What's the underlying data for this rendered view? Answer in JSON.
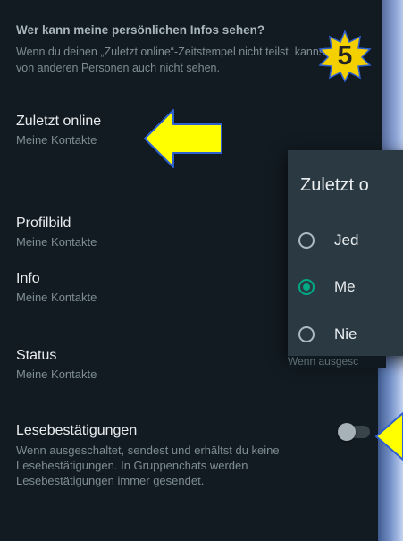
{
  "header": {
    "title": "Wer kann meine persönlichen Infos sehen?",
    "description": "Wenn du deinen „Zuletzt online“-Zeitstempel nicht teilst, kannst du den von anderen Personen auch nicht sehen."
  },
  "settings": {
    "last_seen": {
      "title": "Zuletzt online",
      "value": "Meine Kontakte"
    },
    "profile_photo": {
      "title": "Profilbild",
      "value": "Meine Kontakte"
    },
    "about": {
      "title": "Info",
      "value": "Meine Kontakte"
    },
    "status": {
      "title": "Status",
      "value": "Meine Kontakte"
    },
    "read_receipts": {
      "title": "Lesebestätigungen",
      "description": "Wenn ausgeschaltet, sendest und erhältst du keine Lesebestätigungen. In Gruppenchats werden Lesebestätigungen immer gesendet.",
      "enabled": false
    }
  },
  "dialog": {
    "title": "Zuletzt o",
    "options": [
      {
        "label": "Jed",
        "checked": false
      },
      {
        "label": "Me",
        "checked": true
      },
      {
        "label": "Nie",
        "checked": false
      }
    ],
    "footer_peek": "Wenn ausgesc"
  },
  "badge": {
    "number": "5",
    "color": "#f5d000"
  },
  "colors": {
    "background": "#121b22",
    "accent": "#00a884",
    "arrow": "#ffff00"
  }
}
